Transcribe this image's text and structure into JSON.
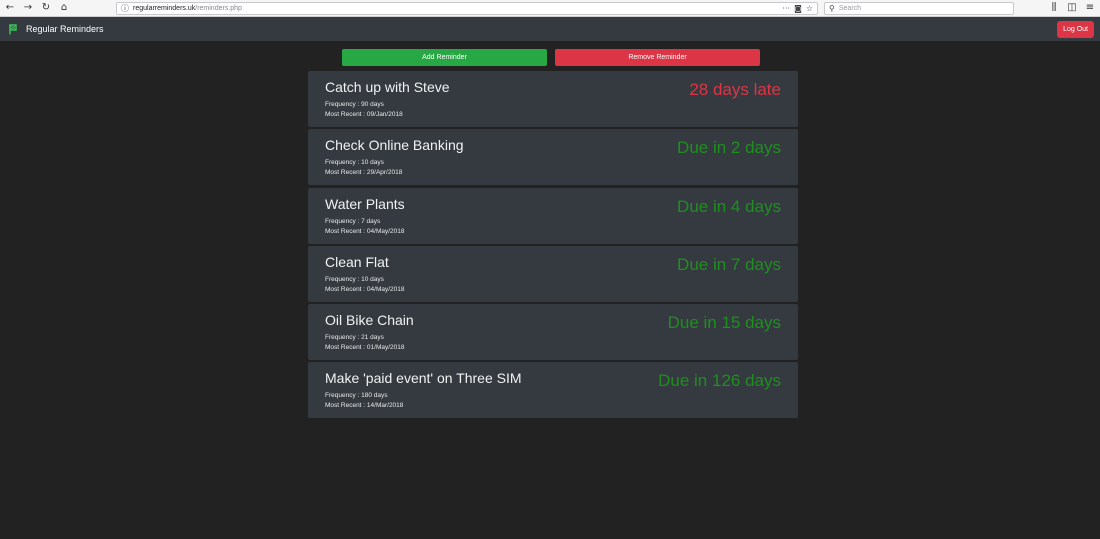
{
  "browser": {
    "url_host": "regularreminders.uk",
    "url_path": "/reminders.php",
    "search_placeholder": "Search"
  },
  "navbar": {
    "brand": "Regular Reminders",
    "logout_label": "Log Out"
  },
  "actions": {
    "add_label": "Add Reminder",
    "remove_label": "Remove Reminder"
  },
  "reminders": [
    {
      "title": "Catch up with Steve",
      "frequency": "Frequency : 90 days",
      "most_recent": "Most Recent : 09/Jan/2018",
      "status": "28 days late",
      "state": "late"
    },
    {
      "title": "Check Online Banking",
      "frequency": "Frequency : 10 days",
      "most_recent": "Most Recent : 29/Apr/2018",
      "status": "Due in 2 days",
      "state": "due"
    },
    {
      "title": "Water Plants",
      "frequency": "Frequency : 7 days",
      "most_recent": "Most Recent : 04/May/2018",
      "status": "Due in 4 days",
      "state": "due"
    },
    {
      "title": "Clean Flat",
      "frequency": "Frequency : 10 days",
      "most_recent": "Most Recent : 04/May/2018",
      "status": "Due in 7 days",
      "state": "due"
    },
    {
      "title": "Oil Bike Chain",
      "frequency": "Frequency : 21 days",
      "most_recent": "Most Recent : 01/May/2018",
      "status": "Due in 15 days",
      "state": "due"
    },
    {
      "title": "Make 'paid event' on Three SIM",
      "frequency": "Frequency : 180 days",
      "most_recent": "Most Recent : 14/Mar/2018",
      "status": "Due in 126 days",
      "state": "due"
    }
  ],
  "colors": {
    "late": "#dc3545",
    "due": "#1e8f1e",
    "add": "#28a745",
    "remove": "#dc3545"
  }
}
